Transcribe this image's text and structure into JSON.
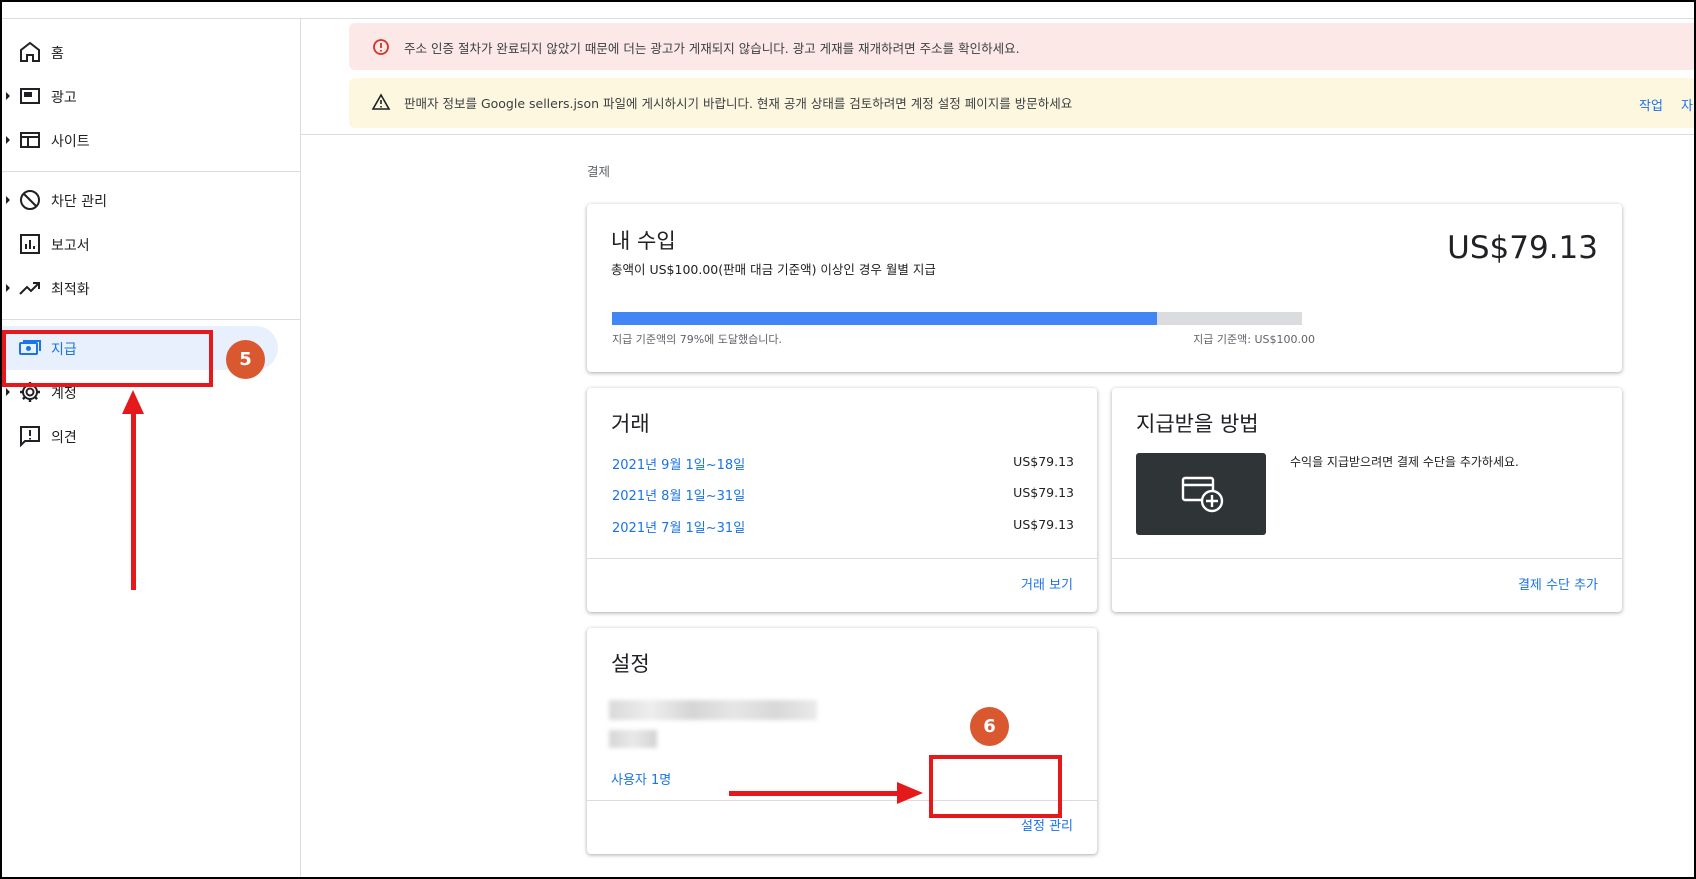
{
  "sidebar": {
    "items": [
      {
        "label": "홈",
        "icon": "home-icon"
      },
      {
        "label": "광고",
        "icon": "ads-icon"
      },
      {
        "label": "사이트",
        "icon": "sites-icon"
      },
      {
        "label": "차단 관리",
        "icon": "block-icon"
      },
      {
        "label": "보고서",
        "icon": "reports-icon"
      },
      {
        "label": "최적화",
        "icon": "trending-up-icon"
      },
      {
        "label": "지급",
        "icon": "payments-icon"
      },
      {
        "label": "계정",
        "icon": "gear-icon"
      },
      {
        "label": "의견",
        "icon": "feedback-icon"
      }
    ]
  },
  "alerts": {
    "error": {
      "text": "주소 인증 절차가 완료되지 않았기 때문에 더는 광고가 게재되지 않습니다. 광고 게재를 재개하려면 주소를 확인하세요.",
      "icon": "error-icon"
    },
    "warning": {
      "text": "판매자 정보를 Google sellers.json 파일에 게시하시기 바랍니다. 현재 공개 상태를 검토하려면 계정 설정 페이지를 방문하세요",
      "action": "작업",
      "action2": "자",
      "icon": "warning-icon"
    }
  },
  "breadcrumb": "결제",
  "earnings": {
    "title": "내 수입",
    "subtitle": "총액이 US$100.00(판매 대금 기준액) 이상인 경우 월별 지급",
    "amount": "US$79.13",
    "progress_fraction": 0.79,
    "progress_text": "지급 기준액의 79%에 도달했습니다.",
    "threshold_text": "지급 기준액: US$100.00"
  },
  "transactions": {
    "title": "거래",
    "rows": [
      {
        "date": "2021년 9월 1일~18일",
        "value": "US$79.13"
      },
      {
        "date": "2021년 8월 1일~31일",
        "value": "US$79.13"
      },
      {
        "date": "2021년 7월 1일~31일",
        "value": "US$79.13"
      }
    ],
    "link": "거래 보기"
  },
  "payment_method": {
    "title": "지급받을 방법",
    "description": "수익을 지급받으려면 결제 수단을 추가하세요.",
    "link": "결제 수단 추가",
    "icon": "add-card-icon"
  },
  "settings": {
    "title": "설정",
    "users_link": "사용자 1명",
    "manage_link": "설정 관리"
  },
  "annotations": {
    "step5": "5",
    "step6": "6",
    "highlight_color": "#e5191c",
    "badge_color": "#d9582f"
  },
  "colors": {
    "accent": "#1a73e8",
    "progress_fill": "#4285f4",
    "error_bg": "#fce8e6",
    "warning_bg": "#fef7e0"
  }
}
